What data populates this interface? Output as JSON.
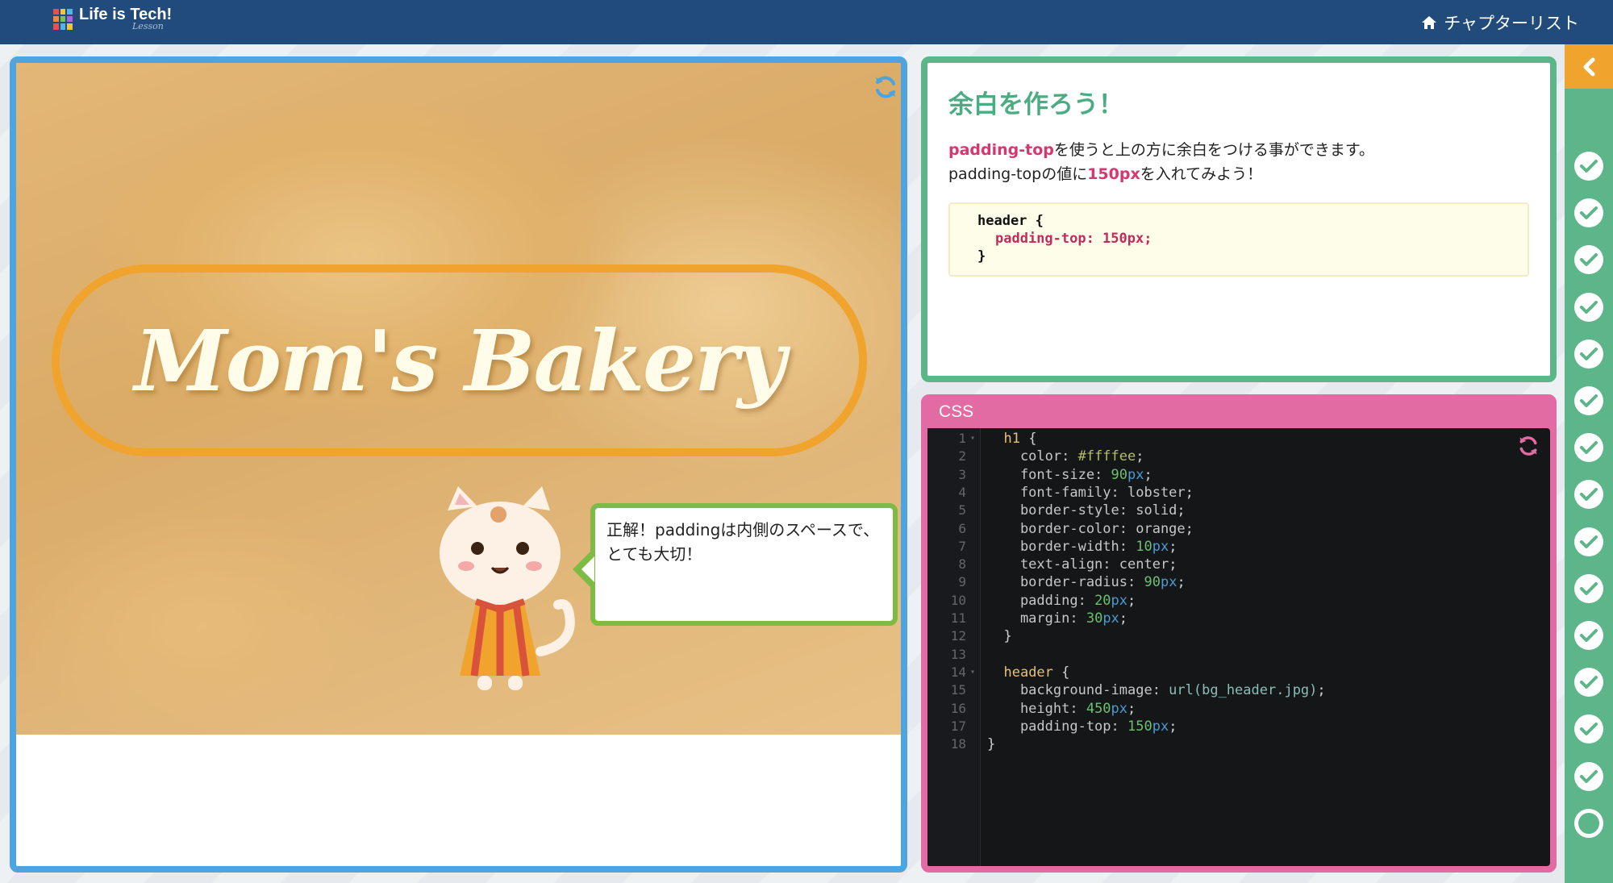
{
  "header": {
    "logo_text": "Life is Tech!",
    "logo_sub": "Lesson",
    "chapter_list": "チャプターリスト"
  },
  "preview": {
    "title": "Mom's Bakery",
    "speech": "正解！paddingは内側のスペースで、とても大切！"
  },
  "instructions": {
    "heading": "余白を作ろう！",
    "line1_highlight": "padding-top",
    "line1_rest": "を使うと上の方に余白をつける事ができます。",
    "line2_start": "padding-topの値に",
    "line2_highlight": "150px",
    "line2_end": "を入れてみよう！",
    "code": [
      "header {",
      "padding-top: 150px;",
      "}"
    ]
  },
  "css_editor": {
    "label": "CSS",
    "lines": [
      {
        "n": "1",
        "fold": true,
        "parts": [
          [
            "  ",
            ""
          ],
          [
            "h1",
            "sel"
          ],
          [
            " {",
            "brace"
          ]
        ]
      },
      {
        "n": "2",
        "parts": [
          [
            "    color: ",
            "prop"
          ],
          [
            "#ffffee",
            "val"
          ],
          [
            ";",
            "brace"
          ]
        ]
      },
      {
        "n": "3",
        "parts": [
          [
            "    font-size: ",
            "prop"
          ],
          [
            "90",
            "num"
          ],
          [
            "px",
            "unit"
          ],
          [
            ";",
            "brace"
          ]
        ]
      },
      {
        "n": "4",
        "parts": [
          [
            "    font-family: ",
            "prop"
          ],
          [
            "lobster",
            "prop"
          ],
          [
            ";",
            "brace"
          ]
        ]
      },
      {
        "n": "5",
        "parts": [
          [
            "    border-style: ",
            "prop"
          ],
          [
            "solid",
            "prop"
          ],
          [
            ";",
            "brace"
          ]
        ]
      },
      {
        "n": "6",
        "parts": [
          [
            "    border-color: ",
            "prop"
          ],
          [
            "orange",
            "prop"
          ],
          [
            ";",
            "brace"
          ]
        ]
      },
      {
        "n": "7",
        "parts": [
          [
            "    border-width: ",
            "prop"
          ],
          [
            "10",
            "num"
          ],
          [
            "px",
            "unit"
          ],
          [
            ";",
            "brace"
          ]
        ]
      },
      {
        "n": "8",
        "parts": [
          [
            "    text-align: ",
            "prop"
          ],
          [
            "center",
            "prop"
          ],
          [
            ";",
            "brace"
          ]
        ]
      },
      {
        "n": "9",
        "parts": [
          [
            "    border-radius: ",
            "prop"
          ],
          [
            "90",
            "num"
          ],
          [
            "px",
            "unit"
          ],
          [
            ";",
            "brace"
          ]
        ]
      },
      {
        "n": "10",
        "parts": [
          [
            "    padding: ",
            "prop"
          ],
          [
            "20",
            "num"
          ],
          [
            "px",
            "unit"
          ],
          [
            ";",
            "brace"
          ]
        ]
      },
      {
        "n": "11",
        "parts": [
          [
            "    margin: ",
            "prop"
          ],
          [
            "30",
            "num"
          ],
          [
            "px",
            "unit"
          ],
          [
            ";",
            "brace"
          ]
        ]
      },
      {
        "n": "12",
        "parts": [
          [
            "  }",
            "brace"
          ]
        ]
      },
      {
        "n": "13",
        "parts": [
          [
            "",
            ""
          ]
        ]
      },
      {
        "n": "14",
        "fold": true,
        "parts": [
          [
            "  ",
            ""
          ],
          [
            "header",
            "sel"
          ],
          [
            " {",
            "brace"
          ]
        ]
      },
      {
        "n": "15",
        "parts": [
          [
            "    background-image: ",
            "prop"
          ],
          [
            "url(bg_header.jpg)",
            "str"
          ],
          [
            ";",
            "brace"
          ]
        ]
      },
      {
        "n": "16",
        "parts": [
          [
            "    height: ",
            "prop"
          ],
          [
            "450",
            "num"
          ],
          [
            "px",
            "unit"
          ],
          [
            ";",
            "brace"
          ]
        ]
      },
      {
        "n": "17",
        "parts": [
          [
            "    padding-top: ",
            "prop"
          ],
          [
            "150",
            "num"
          ],
          [
            "px",
            "unit"
          ],
          [
            ";",
            "brace"
          ]
        ]
      },
      {
        "n": "18",
        "parts": [
          [
            "}",
            "brace"
          ]
        ]
      }
    ]
  },
  "progress": {
    "completed": 14,
    "current": 1
  },
  "colors": {
    "topbar": "#204b7a",
    "preview_border": "#4da4e0",
    "instructions_border": "#5db58a",
    "css_border": "#e36ba4",
    "accent_orange": "#f0a42e",
    "highlight_pink": "#d9356f"
  },
  "icons": [
    "home-icon",
    "refresh-icon",
    "chevron-left-icon",
    "check-circle-icon"
  ]
}
